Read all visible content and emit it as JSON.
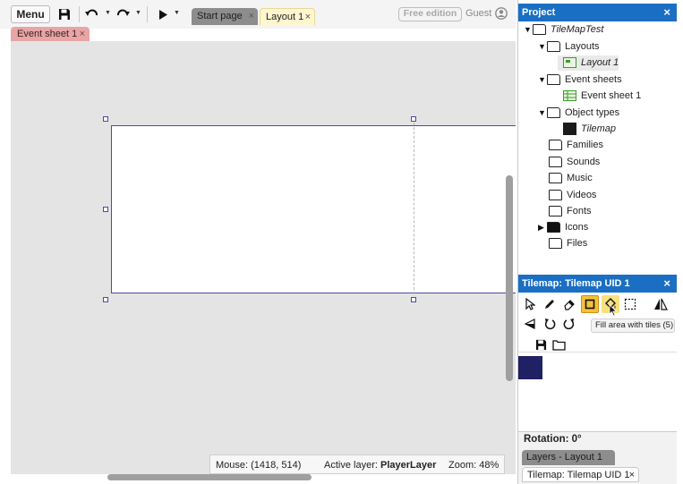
{
  "toolbar": {
    "menu_label": "Menu",
    "save_icon": "save-icon",
    "undo_icon": "undo-icon",
    "redo_icon": "redo-icon",
    "play_icon": "play-icon",
    "free_edition_label": "Free edition",
    "guest_label": "Guest"
  },
  "doc_tabs": [
    {
      "label": "Start page",
      "close": "×"
    },
    {
      "label": "Layout 1",
      "close": "×"
    }
  ],
  "event_tab": {
    "label": "Event sheet 1",
    "close": "×"
  },
  "statusbar": {
    "mouse": "Mouse: (1418, 514)",
    "active_layer_label": "Active layer:",
    "active_layer_value": "PlayerLayer",
    "zoom": "Zoom: 48%"
  },
  "project_panel": {
    "title": "Project",
    "close": "×",
    "tree": {
      "root": "TileMapTest",
      "layouts_folder": "Layouts",
      "layout_item": "Layout 1",
      "event_sheets_folder": "Event sheets",
      "event_sheet_item": "Event sheet 1",
      "object_types_folder": "Object types",
      "object_type_item": "Tilemap",
      "families": "Families",
      "sounds": "Sounds",
      "music": "Music",
      "videos": "Videos",
      "fonts": "Fonts",
      "icons": "Icons",
      "files": "Files"
    }
  },
  "tilemap_panel": {
    "title": "Tilemap: Tilemap UID 1",
    "close": "×",
    "tooltip": "Fill area with tiles (5)",
    "active_tool": "rectangle-tool",
    "colors": {
      "active_tool_bg": "#f3c13a",
      "accent": "#1a6fc4"
    }
  },
  "rotation_label": "Rotation: 0°",
  "bottom_tabs": {
    "layers": {
      "label": "Layers - Layout 1"
    },
    "tilemap": {
      "label": "Tilemap: Tilemap UID 1",
      "close": "×"
    }
  }
}
